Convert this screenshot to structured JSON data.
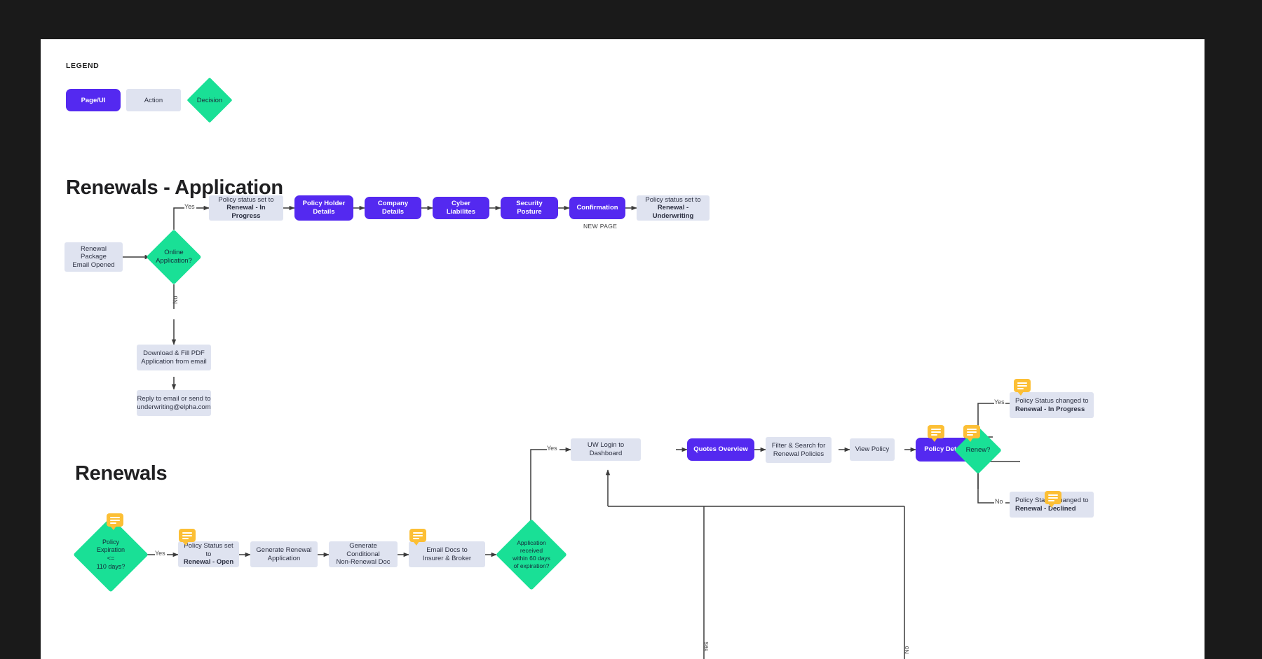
{
  "legend": {
    "title": "LEGEND",
    "items": [
      {
        "label": "Page/UI",
        "type": "page",
        "color": "#5429f0"
      },
      {
        "label": "Action",
        "type": "action",
        "color": "#dfe3f0"
      },
      {
        "label": "Decision",
        "type": "decision",
        "color": "#19e096"
      }
    ]
  },
  "sections": {
    "application_title": "Renewals - Application",
    "renewals_title": "Renewals"
  },
  "application_flow": {
    "start": {
      "line1": "Renewal Package",
      "line2": "Email Opened"
    },
    "decision": {
      "line1": "Online",
      "line2": "Application?"
    },
    "yes_label": "Yes",
    "no_label": "No",
    "yes_branch": [
      {
        "line1": "Policy status set to",
        "line2": "Renewal - In Progress",
        "type": "action"
      },
      {
        "line1": "Policy Holder",
        "line2": "Details",
        "type": "page"
      },
      {
        "line1": "Company Details",
        "line2": "",
        "type": "page"
      },
      {
        "line1": "Cyber Liabilites",
        "line2": "",
        "type": "page"
      },
      {
        "line1": "Security Posture",
        "line2": "",
        "type": "page"
      },
      {
        "line1": "Confirmation",
        "line2": "",
        "type": "page"
      },
      {
        "line1": "Policy status set to",
        "line2": "Renewal - Underwriting",
        "type": "action"
      }
    ],
    "confirmation_sublabel": "NEW PAGE",
    "no_branch": [
      {
        "line1": "Download & Fill PDF",
        "line2": "Application from email"
      },
      {
        "line1": "Reply to email or send to",
        "line2": "underwriting@elpha.com"
      }
    ]
  },
  "renewals_flow": {
    "expiration_decision": {
      "line1": "Policy",
      "line2": "Expiration",
      "line3": "<=",
      "line4": "110 days?"
    },
    "yes_label": "Yes",
    "no_label": "No",
    "chain": [
      {
        "line1": "Policy Status set to",
        "line2": "Renewal - Open",
        "type": "action",
        "badge": true
      },
      {
        "line1": "Generate Renewal",
        "line2": "Application",
        "type": "action",
        "badge": false
      },
      {
        "line1": "Generate Conditional",
        "line2": "Non-Renewal Doc",
        "type": "action",
        "badge": false
      },
      {
        "line1": "Email Docs to",
        "line2": "Insurer & Broker",
        "type": "action",
        "badge": true
      }
    ],
    "received_decision": {
      "line1": "Application",
      "line2": "received",
      "line3": "within 60 days",
      "line4": "of expiration?"
    },
    "uw_chain": [
      {
        "line1": "UW Login to Dashboard",
        "line2": "",
        "type": "action",
        "badge": false
      },
      {
        "line1": "Quotes Overview",
        "line2": "",
        "type": "page",
        "badge": false
      },
      {
        "line1": "Filter & Search for",
        "line2": "Renewal Policies",
        "type": "action",
        "badge": false
      },
      {
        "line1": "View Policy",
        "line2": "",
        "type": "action",
        "badge": false
      },
      {
        "line1": "Policy Detail",
        "line2": "",
        "type": "page",
        "badge": true
      }
    ],
    "renew_decision": {
      "line1": "Renew?"
    },
    "outcome_yes": {
      "line1": "Policy Status changed to",
      "line2": "Renewal - In Progress"
    },
    "outcome_no": {
      "line1": "Policy Status changed to",
      "line2": "Renewal - Declined"
    },
    "loop_label_yes": "Yes",
    "loop_label_no": "No"
  },
  "colors": {
    "page": "#5429f0",
    "action": "#dfe3f0",
    "decision": "#19e096",
    "badge": "#fcbf35",
    "edge": "#3c3c3c",
    "canvas": "#ffffff",
    "backdrop": "#1a1a1a"
  }
}
